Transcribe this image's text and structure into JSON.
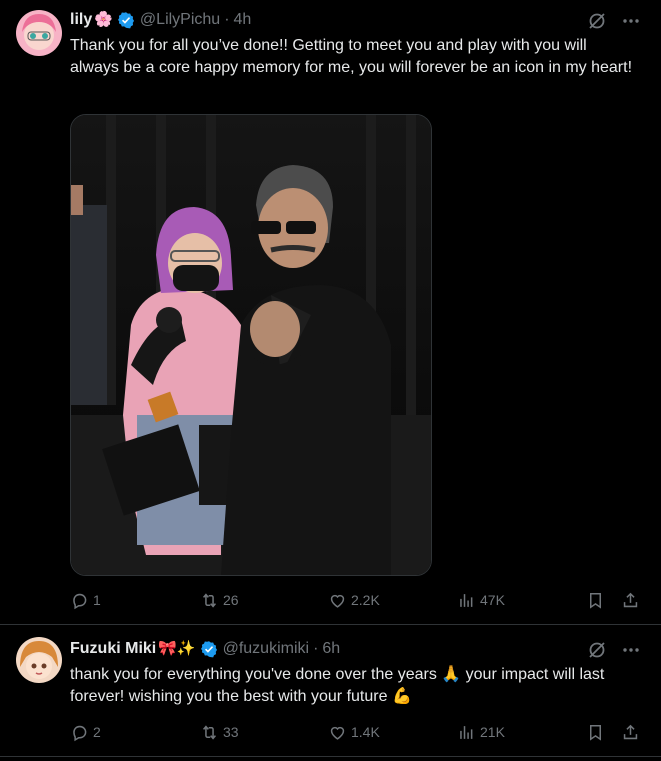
{
  "tweets": [
    {
      "author": {
        "name": "lily",
        "name_emoji": "🌸",
        "handle": "@LilyPichu",
        "time": "4h"
      },
      "text": "Thank you for all you’ve done!! Getting to meet you and play with you will always be a core happy memory for me, you will forever be an icon in my heart!",
      "stats": {
        "replies": "1",
        "reposts": "26",
        "likes": "2.2K",
        "views": "47K"
      }
    },
    {
      "author": {
        "name": "Fuzuki Miki",
        "name_emoji": "🎀✨",
        "handle": "@fuzukimiki",
        "time": "6h"
      },
      "text": "thank you for everything you've done over the years 🙏 your impact will last forever! wishing you the best with your future 💪",
      "stats": {
        "replies": "2",
        "reposts": "33",
        "likes": "1.4K",
        "views": "21K"
      }
    }
  ],
  "dot_separator": "·",
  "colors": {
    "background": "#000000",
    "text": "#e7e9ea",
    "muted": "#71767b",
    "verified": "#1d9bf0",
    "border": "#2f3336"
  },
  "icons": [
    "verified-badge-icon",
    "grok-icon",
    "more-icon",
    "reply-icon",
    "repost-icon",
    "like-icon",
    "views-icon",
    "bookmark-icon",
    "share-icon"
  ]
}
